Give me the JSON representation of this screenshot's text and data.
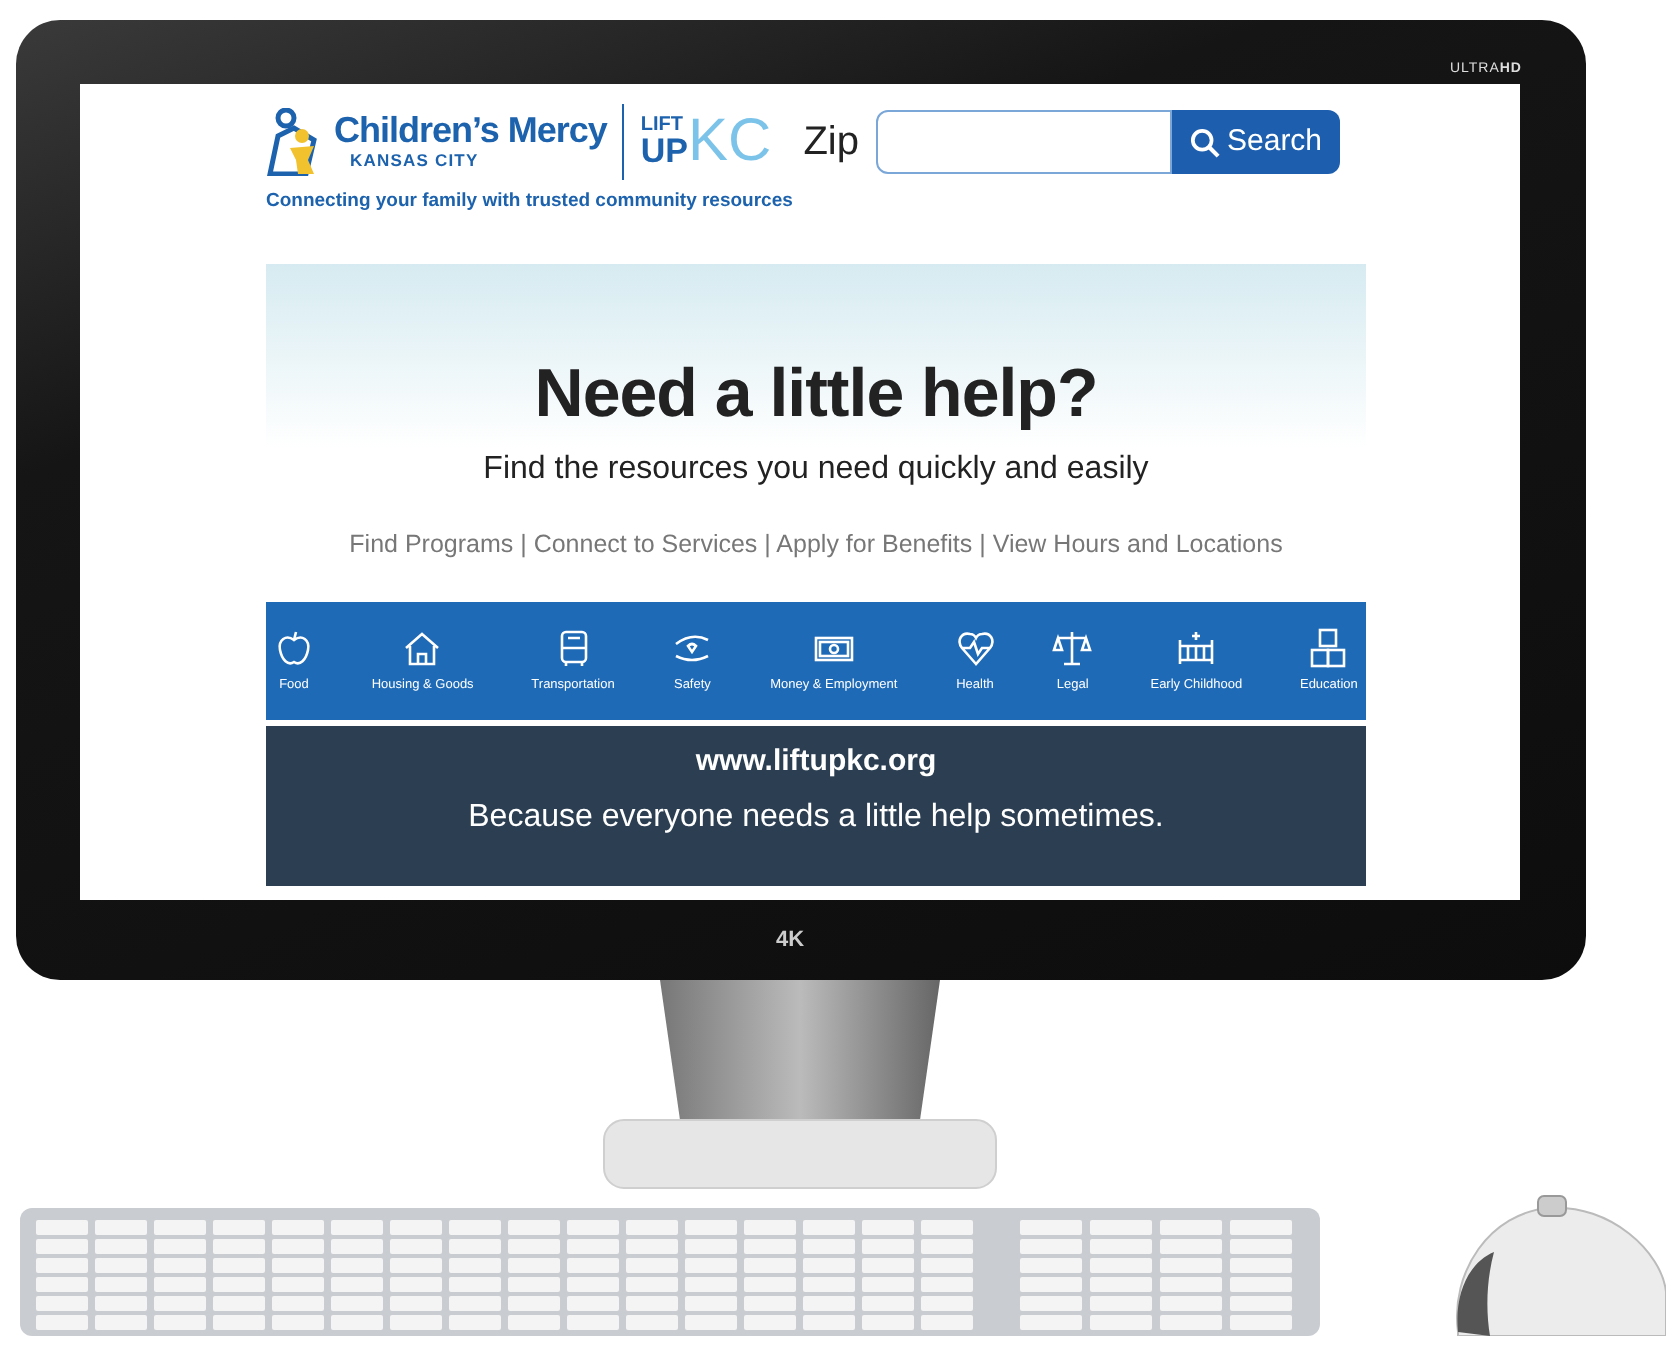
{
  "monitor": {
    "brand": "ULTRA**HD**",
    "badge": "4K"
  },
  "page": {
    "logo": {
      "name": "Children’s Mercy",
      "city": "KANSAS CITY",
      "partner_top": "LIFT",
      "partner_bottom": "UP",
      "partner_side": "KC"
    },
    "search": {
      "label": "Zip",
      "button": "Search"
    },
    "tagline": "Connecting your family with trusted community resources",
    "hero": {
      "title": "Need a little help?",
      "subtitle": "Find the resources you need quickly and easily",
      "links": "Find Programs | Connect to Services | Apply for Benefits | View Hours and Locations"
    },
    "categories": [
      {
        "label": "Food",
        "kind": "food"
      },
      {
        "label": "Housing & Goods",
        "kind": "housing"
      },
      {
        "label": "Transportation",
        "kind": "transportation"
      },
      {
        "label": "Safety",
        "kind": "safety"
      },
      {
        "label": "Money & Employment",
        "kind": "money"
      },
      {
        "label": "Health",
        "kind": "health"
      },
      {
        "label": "Legal",
        "kind": "legal"
      },
      {
        "label": "Early Childhood",
        "kind": "childhood"
      },
      {
        "label": "Education",
        "kind": "education"
      }
    ],
    "footer": {
      "url": "www.liftupkc.org",
      "message": "Because everyone needs a little help sometimes."
    }
  }
}
